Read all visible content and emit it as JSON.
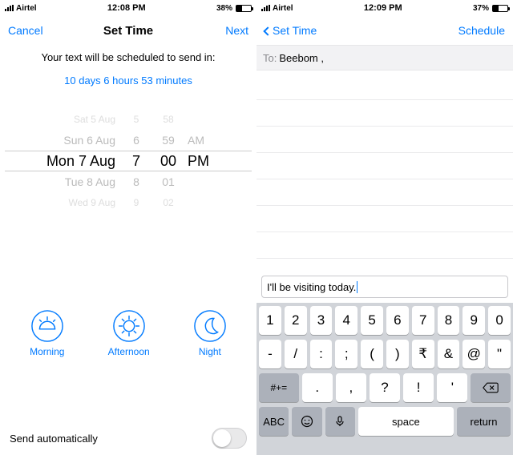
{
  "left": {
    "status": {
      "carrier": "Airtel",
      "time": "12:08 PM",
      "battery": "38%"
    },
    "nav": {
      "cancel": "Cancel",
      "title": "Set Time",
      "next": "Next"
    },
    "subtitle": "Your text will be scheduled to send in:",
    "countdown": "10 days 6 hours 53 minutes",
    "picker": {
      "dates": [
        "Sat 5 Aug",
        "Sun 6 Aug",
        "Mon 7 Aug",
        "Tue 8 Aug",
        "Wed 9 Aug"
      ],
      "hours": [
        "5",
        "6",
        "7",
        "8",
        "9"
      ],
      "mins": [
        "58",
        "59",
        "00",
        "01",
        "02"
      ],
      "ampm": [
        "",
        "AM",
        "PM",
        "",
        ""
      ]
    },
    "shortcuts": {
      "morning": "Morning",
      "afternoon": "Afternoon",
      "night": "Night"
    },
    "auto": {
      "label": "Send automatically"
    }
  },
  "right": {
    "status": {
      "carrier": "Airtel",
      "time": "12:09 PM",
      "battery": "37%"
    },
    "nav": {
      "back": "Set Time",
      "schedule": "Schedule"
    },
    "to_prefix": "To:",
    "to_value": "Beebom ,",
    "message": "I'll be visiting today.",
    "keys_r1": [
      "1",
      "2",
      "3",
      "4",
      "5",
      "6",
      "7",
      "8",
      "9",
      "0"
    ],
    "keys_r2": [
      "-",
      "/",
      ":",
      ";",
      "(",
      ")",
      "₹",
      "&",
      "@",
      "\""
    ],
    "keys_r3_shift": "#+=",
    "keys_r3": [
      ".",
      ",",
      "?",
      "!",
      "'"
    ],
    "keys_r4": {
      "abc": "ABC",
      "space": "space",
      "ret": "return"
    }
  }
}
